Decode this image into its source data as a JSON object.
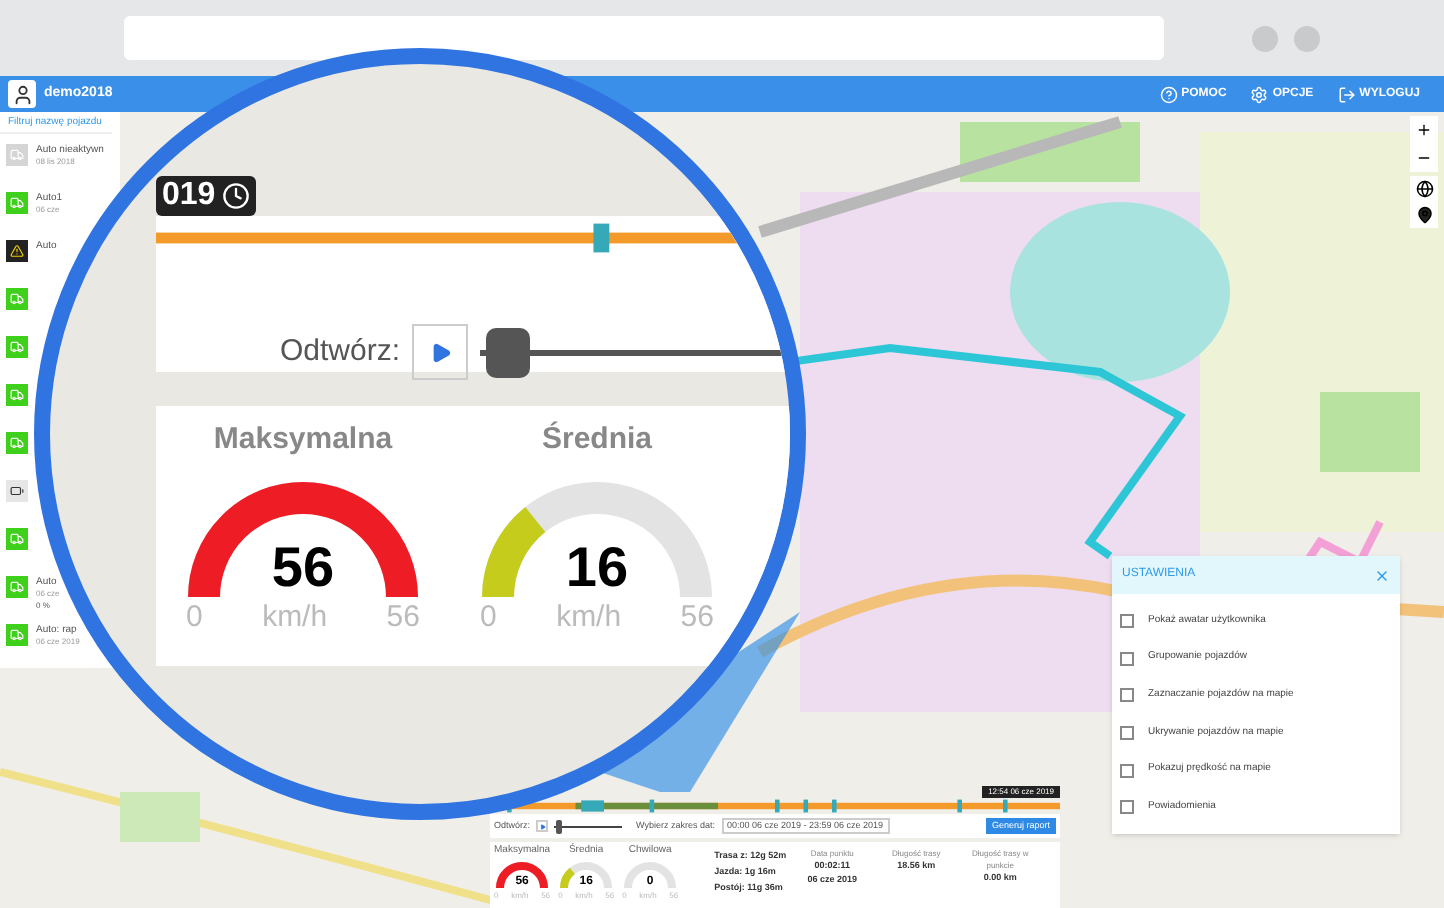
{
  "header": {
    "user": "demo2018",
    "links": [
      {
        "label": "POMOC"
      },
      {
        "label": "OPCJE"
      },
      {
        "label": "WYLOGUJ"
      }
    ]
  },
  "sidebar": {
    "filter_placeholder": "Filtruj nazwę pojazdu",
    "vehicles": [
      {
        "name": "Auto nieaktywn",
        "date": "08 lis 2018",
        "kind": "inactive"
      },
      {
        "name": "Auto1",
        "date": "06 cze",
        "kind": "active"
      },
      {
        "name": "Auto",
        "kind": "alert"
      },
      {
        "kind": "active"
      },
      {
        "kind": "active"
      },
      {
        "kind": "active"
      },
      {
        "kind": "active"
      },
      {
        "kind": "battery"
      },
      {
        "kind": "active"
      },
      {
        "name": "Auto",
        "date": "06 cze",
        "extra": "0 %",
        "kind": "active"
      },
      {
        "name": "Auto: rap",
        "date": "06 cze 2019",
        "kind": "active"
      }
    ]
  },
  "settings": {
    "title": "USTAWIENIA",
    "options": [
      {
        "label": "Pokaż awatar użytkownika",
        "checked": false
      },
      {
        "label": "Grupowanie pojazdów",
        "checked": false
      },
      {
        "label": "Zaznaczanie pojazdów na mapie",
        "checked": false
      },
      {
        "label": "Ukrywanie pojazdów na mapie",
        "checked": false
      },
      {
        "label": "Pokazuj prędkość na mapie",
        "checked": false
      },
      {
        "label": "Powiadomienia",
        "checked": false
      }
    ]
  },
  "playback": {
    "timestamp": "12:54 06 cze 2019",
    "play_label": "Odtwórz:",
    "position": {
      "level": 0.02
    },
    "range_label": "Wybierz zakres dat:",
    "range_value": "00:00 06 cze 2019 - 23:59 06 cze 2019",
    "report_button": "Generuj raport",
    "gauges": [
      {
        "title": "Maksymalna",
        "value": "56",
        "unit": "km/h",
        "min": "0",
        "max": "56",
        "color": "#ee1c25"
      },
      {
        "title": "Średnia",
        "value": "16",
        "unit": "km/h",
        "min": "0",
        "max": "56",
        "color": "#c5cc1b"
      },
      {
        "title": "Chwilowa",
        "value": "0",
        "unit": "km/h",
        "min": "0",
        "max": "56"
      }
    ],
    "durations": [
      {
        "label": "Trasa z:",
        "value": "12g 52m"
      },
      {
        "label": "Jazda:",
        "value": "1g 16m"
      },
      {
        "label": "Postój:",
        "value": "11g 36m"
      }
    ],
    "stats": [
      {
        "label": "Data punktu",
        "lines": [
          "00:02:11",
          "06 cze 2019"
        ]
      },
      {
        "label": "Długość trasy",
        "lines": [
          "18.56 km"
        ]
      },
      {
        "label": "Długość trasy w punkcie",
        "lines": [
          "0.00 km"
        ]
      }
    ]
  },
  "magnifier": {
    "date_badge": "019",
    "play_label": "Odtwórz:",
    "position": {
      "level": 0.02
    },
    "gauges": [
      {
        "title": "Maksymalna",
        "value": "56",
        "unit": "km/h",
        "min": "0",
        "max": "56",
        "color": "#ee1c25"
      },
      {
        "title": "Średnia",
        "value": "16",
        "unit": "km/h",
        "min": "0",
        "max": "56",
        "color": "#c5cc1b"
      }
    ]
  }
}
